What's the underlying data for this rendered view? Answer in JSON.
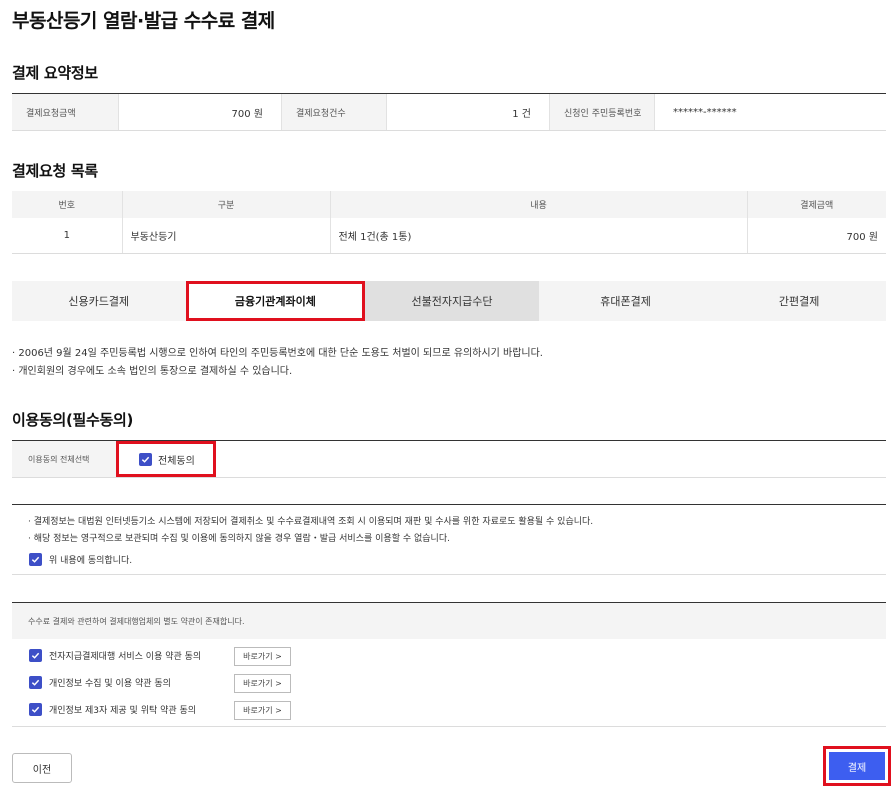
{
  "page_title": "부동산등기 열람·발급 수수료 결제",
  "summary": {
    "title": "결제 요약정보",
    "amount_label": "결제요청금액",
    "amount_value": "700 원",
    "count_label": "결제요청건수",
    "count_value": "1 건",
    "id_label": "신청인 주민등록번호",
    "id_value": "******-******"
  },
  "request_list": {
    "title": "결제요청 목록",
    "headers": [
      "번호",
      "구분",
      "내용",
      "결제금액"
    ],
    "rows": [
      [
        "1",
        "부동산등기",
        "전체 1건(총 1통)",
        "700 원"
      ]
    ]
  },
  "tabs": [
    "신용카드결제",
    "금융기관계좌이체",
    "선불전자지급수단",
    "휴대폰결제",
    "간편결제"
  ],
  "notes": [
    "· 2006년 9월 24일 주민등록법 시행으로 인하여 타인의 주민등록번호에 대한 단순 도용도 처벌이 되므로 유의하시기 바랍니다.",
    "· 개인회원의 경우에도 소속 법인의 통장으로 결제하실 수 있습니다."
  ],
  "consent": {
    "title": "이용동의(필수동의)",
    "select_all_label": "이용동의 전체선택",
    "select_all_text": "전체동의",
    "info_lines": [
      "· 결제정보는 대법원 인터넷등기소 시스템에 저장되어 결제취소 및 수수료결제내역 조회 시 이용되며 재판 및 수사를 위한 자료로도 활용될 수 있습니다.",
      "· 해당 정보는 영구적으로 보관되며 수집 및 이용에 동의하지 않을 경우 열람・발급 서비스를 이용할 수 없습니다."
    ],
    "agree_text": "위 내용에 동의합니다.",
    "terms_head": "수수료 결제와 관련하여 결제대행업체의 별도 약관이 존재합니다.",
    "terms": [
      "전자지급결제대행 서비스 이용 약관 동의",
      "개인정보 수집 및 이용 약관 동의",
      "개인정보 제3자 제공 및 위탁 약관 동의"
    ],
    "goto_label": "바로가기 >"
  },
  "buttons": {
    "prev": "이전",
    "pay": "결제"
  },
  "colors": {
    "accent": "#3d5ef0",
    "checkbox": "#3d4fc7",
    "highlight": "#e0101e"
  }
}
